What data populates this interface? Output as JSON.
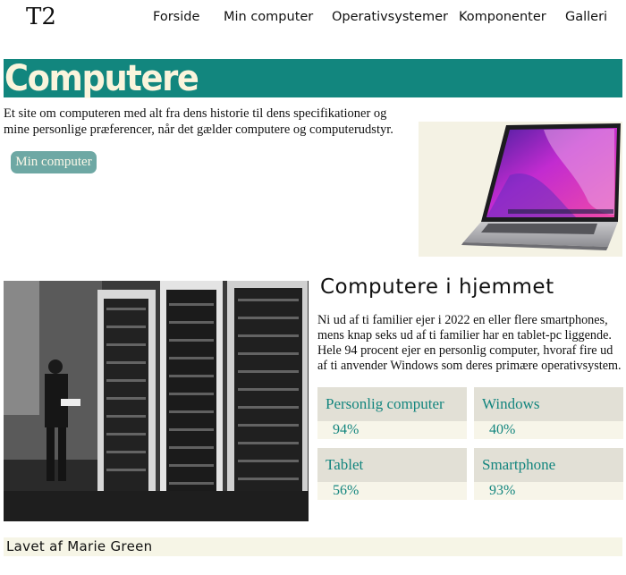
{
  "nav": {
    "logo": "T2",
    "links": [
      "Forside",
      "Min computer",
      "Operativsystemer",
      "Komponenter",
      "Galleri"
    ]
  },
  "hero": {
    "title": "Computere"
  },
  "intro": {
    "text": "Et site om computeren med alt fra dens historie til dens specifikationer og mine personlige præferencer, når det gælder computere og computerudstyr.",
    "button": "Min computer"
  },
  "section": {
    "title": "Computere i hjemmet",
    "text": "Ni ud af ti familier ejer i 2022 en eller flere smartphones, mens knap seks ud af ti familier har en tablet-pc liggende. Hele 94 procent ejer en personlig computer, hvoraf fire ud af ti anvender Windows som deres primære operativsystem."
  },
  "stats": [
    {
      "label": "Personlig computer",
      "value": "94%"
    },
    {
      "label": "Windows",
      "value": "40%"
    },
    {
      "label": "Tablet",
      "value": "56%"
    },
    {
      "label": "Smartphone",
      "value": "93%"
    }
  ],
  "footer": {
    "text": "Lavet af Marie Green"
  },
  "colors": {
    "accent": "#12867e",
    "hero_text": "#faf4dc",
    "button": "#6ea8a4",
    "stat_label_bg": "#e2e0d6",
    "stat_value_bg": "#f7f5e9"
  }
}
